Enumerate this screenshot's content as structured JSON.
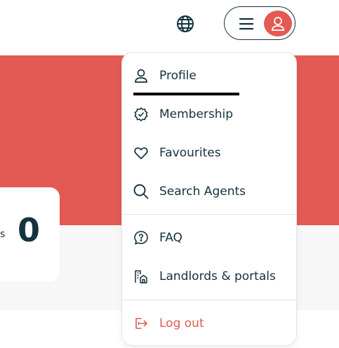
{
  "header": {
    "language_icon": "globe-icon",
    "menu_icon": "hamburger-icon",
    "avatar_icon": "user-icon"
  },
  "stat_card": {
    "label": "s",
    "value": "0"
  },
  "menu": {
    "items": [
      {
        "label": "Profile",
        "icon": "user-icon"
      },
      {
        "label": "Membership",
        "icon": "badge-check-icon"
      },
      {
        "label": "Favourites",
        "icon": "heart-icon"
      },
      {
        "label": "Search Agents",
        "icon": "search-icon"
      },
      {
        "label": "FAQ",
        "icon": "question-icon"
      },
      {
        "label": "Landlords & portals",
        "icon": "buildings-icon"
      },
      {
        "label": "Log out",
        "icon": "logout-icon"
      }
    ]
  },
  "colors": {
    "brand_red": "#e35a54",
    "text_dark": "#14323f",
    "panel_bg": "#f7f7f7"
  }
}
